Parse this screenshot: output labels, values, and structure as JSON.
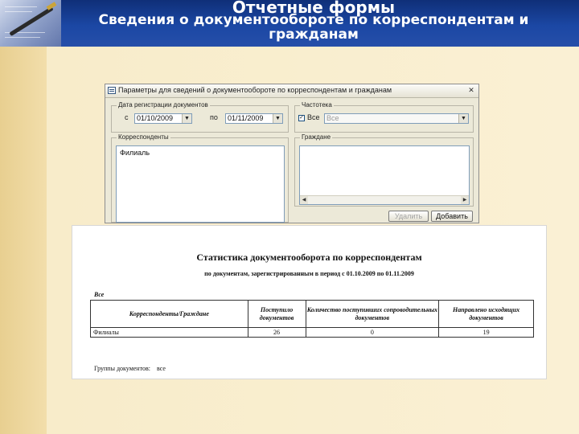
{
  "slide": {
    "title": "Отчетные формы",
    "subtitle_line1": "Сведения о документообороте по корреспондентам и",
    "subtitle_line2": "гражданам"
  },
  "dialog": {
    "title": "Параметры для сведений о документообороте по корреспондентам и гражданам",
    "close_icon": "close-icon",
    "registration_group": {
      "label": "Дата регистрации документов",
      "from_label": "с",
      "from_value": "01/10/2009",
      "to_label": "по",
      "to_value": "01/11/2009"
    },
    "parts_group": {
      "label": "Частотека",
      "all_checkbox_checked": true,
      "all_checkbox_label": "Все",
      "select_value": "Все"
    },
    "correspondents_group": {
      "label": "Корреспонденты",
      "items": [
        "Филиаль"
      ]
    },
    "citizens_group": {
      "label": "Граждане",
      "items": []
    },
    "delete_button": "Удалить",
    "add_button": "Добавить"
  },
  "report": {
    "title": "Статистика документооборота по корреспондентам",
    "subtitle": "по документам, зарегистрированным в период с 01.10.2009 по 01.11.2009",
    "filter_label": "Все",
    "columns": [
      "Корреспонденты/Граждане",
      "Поступило документов",
      "Количество поступивших сопроводительных документов",
      "Направлено исходящих документов"
    ],
    "rows": [
      {
        "name": "Филиалы",
        "received": "26",
        "accompanying": "0",
        "sent": "19"
      }
    ],
    "footer_label": "Группы документов:",
    "footer_value": "все"
  }
}
